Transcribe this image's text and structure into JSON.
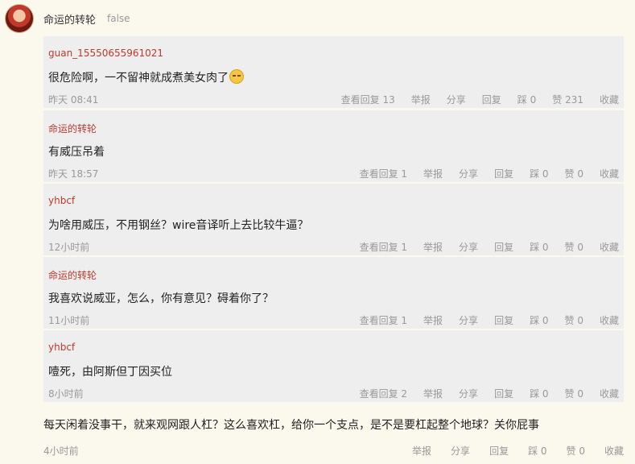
{
  "header": {
    "name": "命运的转轮",
    "flag": "false"
  },
  "replies": [
    {
      "user": "guan_15550655961021",
      "text": "很危险啊，一不留神就成煮美女肉了",
      "emoji": "sleepy-face-icon",
      "time": "昨天 08:41",
      "actions": [
        "查看回复 13",
        "举报",
        "分享",
        "回复",
        "踩 0",
        "赞 231",
        "收藏"
      ]
    },
    {
      "user": "命运的转轮",
      "text": "有威压吊着",
      "time": "昨天 18:57",
      "actions": [
        "查看回复 1",
        "举报",
        "分享",
        "回复",
        "踩 0",
        "赞 0",
        "收藏"
      ]
    },
    {
      "user": "yhbcf",
      "text": "为啥用威压，不用钢丝？wire音译听上去比较牛逼？",
      "time": "12小时前",
      "actions": [
        "查看回复 1",
        "举报",
        "分享",
        "回复",
        "踩 0",
        "赞 0",
        "收藏"
      ]
    },
    {
      "user": "命运的转轮",
      "text": "我喜欢说威亚，怎么，你有意见？碍着你了？",
      "time": "11小时前",
      "actions": [
        "查看回复 1",
        "举报",
        "分享",
        "回复",
        "踩 0",
        "赞 0",
        "收藏"
      ]
    },
    {
      "user": "yhbcf",
      "text": "噎死，由阿斯但丁因买位",
      "time": "8小时前",
      "actions": [
        "查看回复 2",
        "举报",
        "分享",
        "回复",
        "踩 0",
        "赞 0",
        "收藏"
      ]
    }
  ],
  "comment": {
    "text": "每天闲着没事干，就来观网跟人杠？这么喜欢杠，给你一个支点，是不是要杠起整个地球？关你屁事",
    "time": "4小时前",
    "actions": [
      "举报",
      "分享",
      "回复",
      "踩 0",
      "赞 0",
      "收藏"
    ]
  }
}
